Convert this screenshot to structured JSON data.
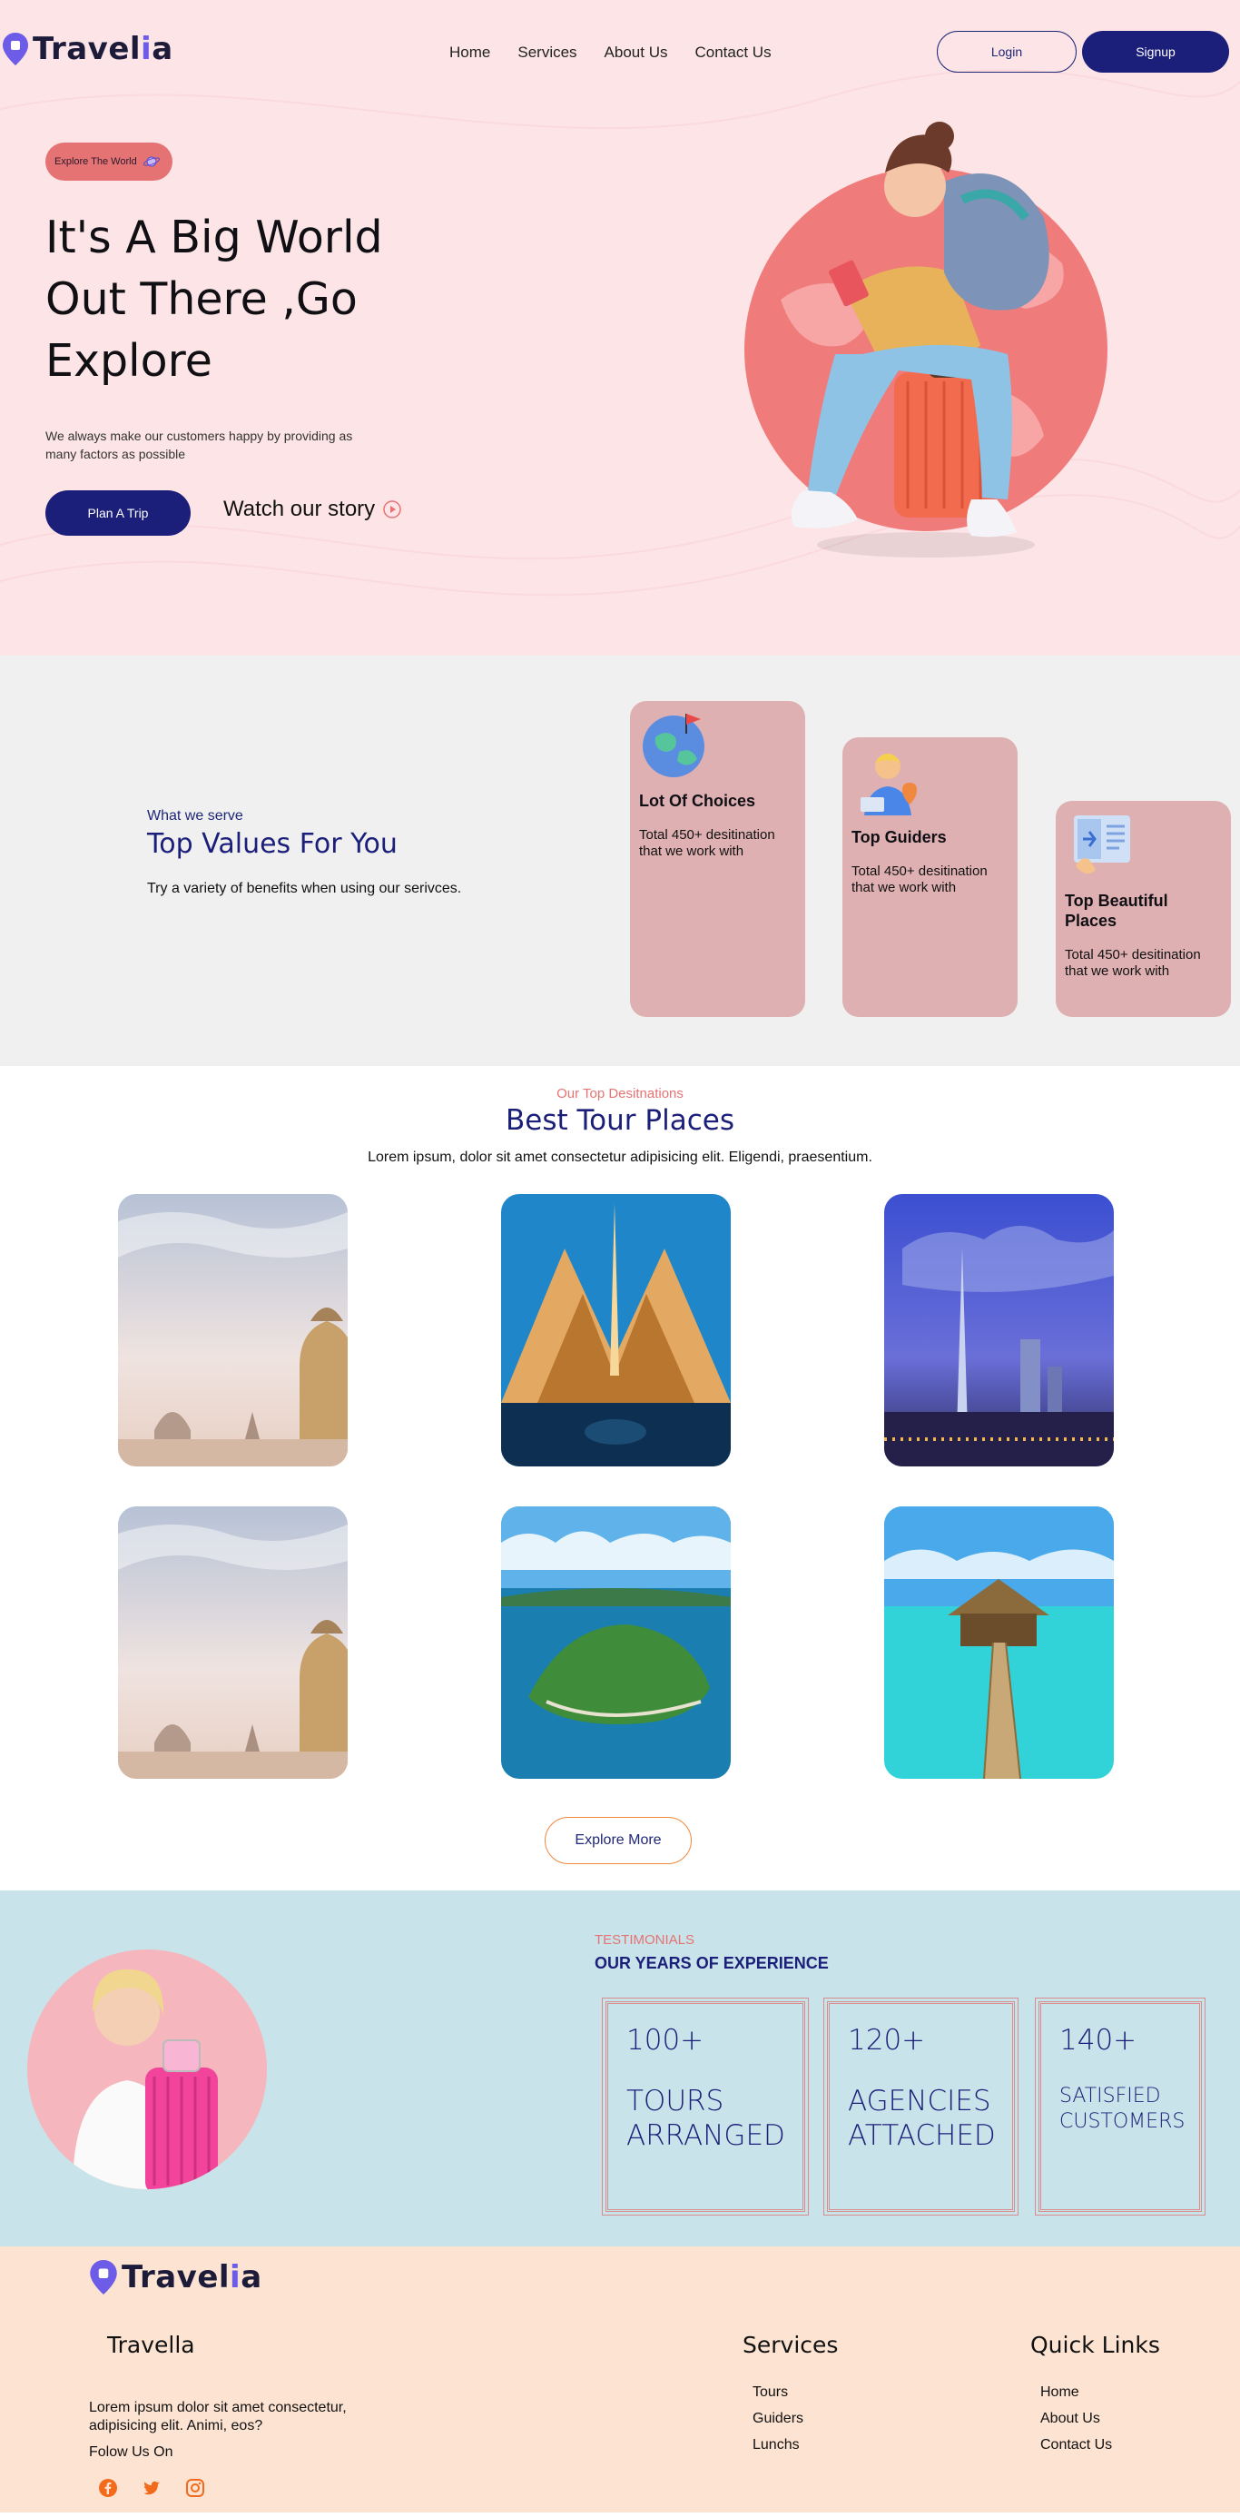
{
  "brand": {
    "name": "Travelia",
    "accent": "#6c5ce7",
    "navy": "#1b1f7a",
    "coral": "#e57373"
  },
  "nav": {
    "items": [
      "Home",
      "Services",
      "About Us",
      "Contact Us"
    ],
    "login": "Login",
    "signup": "Signup"
  },
  "hero": {
    "pill": "Explore The World",
    "title": "It's A Big World Out There ,Go Explore",
    "lead": "We always make our customers happy by providing as many factors as possible",
    "cta": "Plan A Trip",
    "watch": "Watch our story"
  },
  "values": {
    "eyebrow": "What we serve",
    "title": "Top Values For You",
    "subtitle": "Try a variety of benefits when using our serivces.",
    "cards": [
      {
        "title": "Lot Of Choices",
        "text": "Total 450+ desitination that we work with",
        "icon": "globe-icon"
      },
      {
        "title": "Top Guiders",
        "text": "Total 450+ desitination that we work with",
        "icon": "guide-icon"
      },
      {
        "title": "Top Beautiful Places",
        "text": "Total 450+ desitination that we work with",
        "icon": "ticket-icon"
      }
    ]
  },
  "places": {
    "eyebrow": "Our Top Desitnations",
    "title": "Best Tour Places",
    "subtitle": "Lorem ipsum, dolor sit amet consectetur adipisicing elit. Eligendi, praesentium.",
    "button": "Explore More"
  },
  "stats": {
    "eyebrow": "TESTIMONIALS",
    "title": "OUR YEARS OF EXPERIENCE",
    "items": [
      {
        "num": "100+",
        "label": "TOURS ARRANGED"
      },
      {
        "num": "120+",
        "label": "AGENCIES ATTACHED"
      },
      {
        "num": "140+",
        "label": "SATISFIED CUSTOMERS"
      }
    ]
  },
  "footer": {
    "col1_title": "Travella",
    "about": "Lorem ipsum dolor sit amet consectetur, adipisicing elit. Animi, eos?",
    "follow": "Folow Us On",
    "socials": [
      "facebook-icon",
      "twitter-icon",
      "instagram-icon"
    ],
    "services_title": "Services",
    "services": [
      "Tours",
      "Guiders",
      "Lunchs"
    ],
    "links_title": "Quick Links",
    "links": [
      "Home",
      "About Us",
      "Contact Us"
    ]
  }
}
